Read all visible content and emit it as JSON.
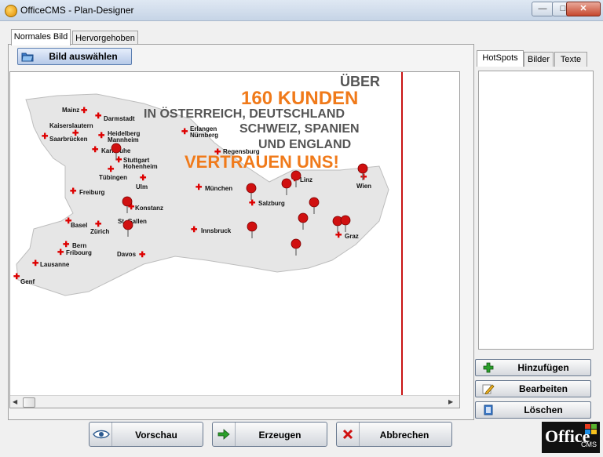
{
  "window": {
    "title": "OfficeCMS - Plan-Designer"
  },
  "tabs_left": [
    {
      "label": "Normales Bild",
      "active": true
    },
    {
      "label": "Hervorgehoben",
      "active": false
    }
  ],
  "toolbar": {
    "select_image_label": "Bild auswählen"
  },
  "map": {
    "headline": [
      "ÜBER",
      "160 KUNDEN",
      "IN ÖSTERREICH, DEUTSCHLAND",
      "SCHWEIZ, SPANIEN",
      "UND ENGLAND",
      "VERTRAUEN UNS!"
    ],
    "accent_color": "#f07a1a",
    "cities": [
      "Mainz",
      "Darmstadt",
      "Kaiserslautern",
      "Heidelberg",
      "Mannheim",
      "Saarbrücken",
      "Karlsruhe",
      "Stuttgart",
      "Hohenheim",
      "Tübingen",
      "Ulm",
      "Erlangen",
      "Nürnberg",
      "Regensburg",
      "München",
      "Freiburg",
      "Konstanz",
      "Basel",
      "Zürich",
      "St. Gallen",
      "Innsbruck",
      "Bern",
      "Fribourg",
      "Davos",
      "Lausanne",
      "Genf",
      "Salzburg",
      "Linz",
      "Wien",
      "Graz"
    ]
  },
  "tabs_right": [
    {
      "label": "HotSpots",
      "active": true
    },
    {
      "label": "Bilder",
      "active": false
    },
    {
      "label": "Texte",
      "active": false
    }
  ],
  "side_actions": {
    "add": "Hinzufügen",
    "edit": "Bearbeiten",
    "delete": "Löschen"
  },
  "bottom_actions": {
    "preview": "Vorschau",
    "generate": "Erzeugen",
    "cancel": "Abbrechen"
  },
  "logo": {
    "brand": "Office",
    "suffix": "CMS"
  }
}
